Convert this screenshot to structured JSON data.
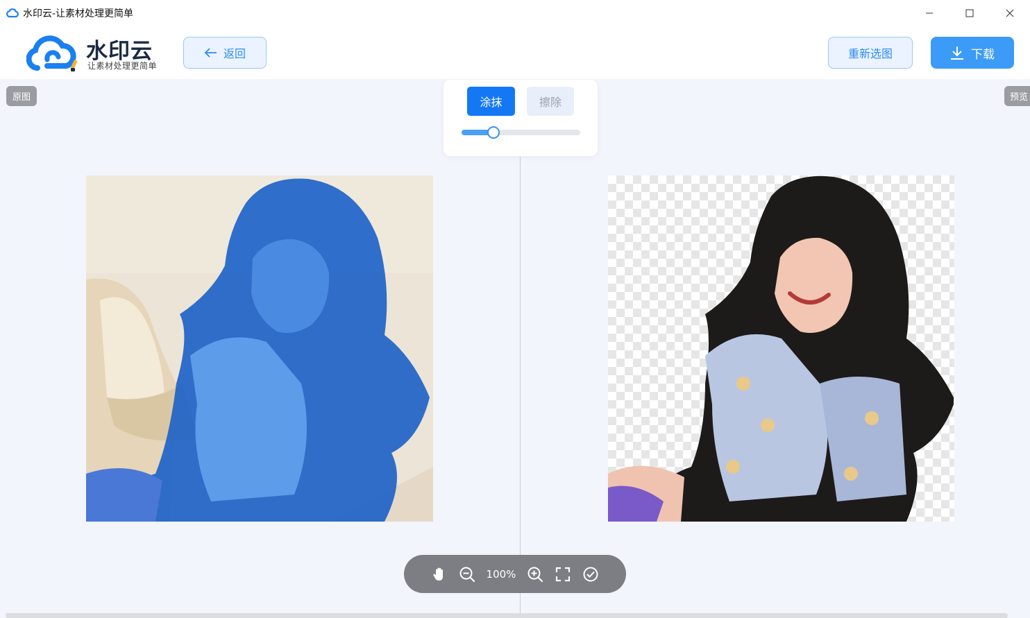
{
  "window": {
    "title": "水印云-让素材处理更简单",
    "minimize_label": "—",
    "maximize_label": "☐",
    "close_label": "✕"
  },
  "header": {
    "brand": "水印云",
    "slogan": "让素材处理更简单",
    "back_label": "返回",
    "reselect_label": "重新选图",
    "download_label": "下载"
  },
  "canvas": {
    "original_label": "原图",
    "preview_label": "预览"
  },
  "brush_panel": {
    "smear_label": "涂抹",
    "erase_label": "擦除",
    "brush_size_fraction": 0.27
  },
  "zoombar": {
    "zoom_level": "100%"
  },
  "colors": {
    "accent": "#1478f5",
    "mask_blue": "#1e63c8"
  },
  "icons": [
    "cloud-logo-icon",
    "arrow-left-icon",
    "download-icon",
    "hand-icon",
    "zoom-out-icon",
    "zoom-in-icon",
    "fullscreen-icon",
    "check-circle-icon"
  ]
}
